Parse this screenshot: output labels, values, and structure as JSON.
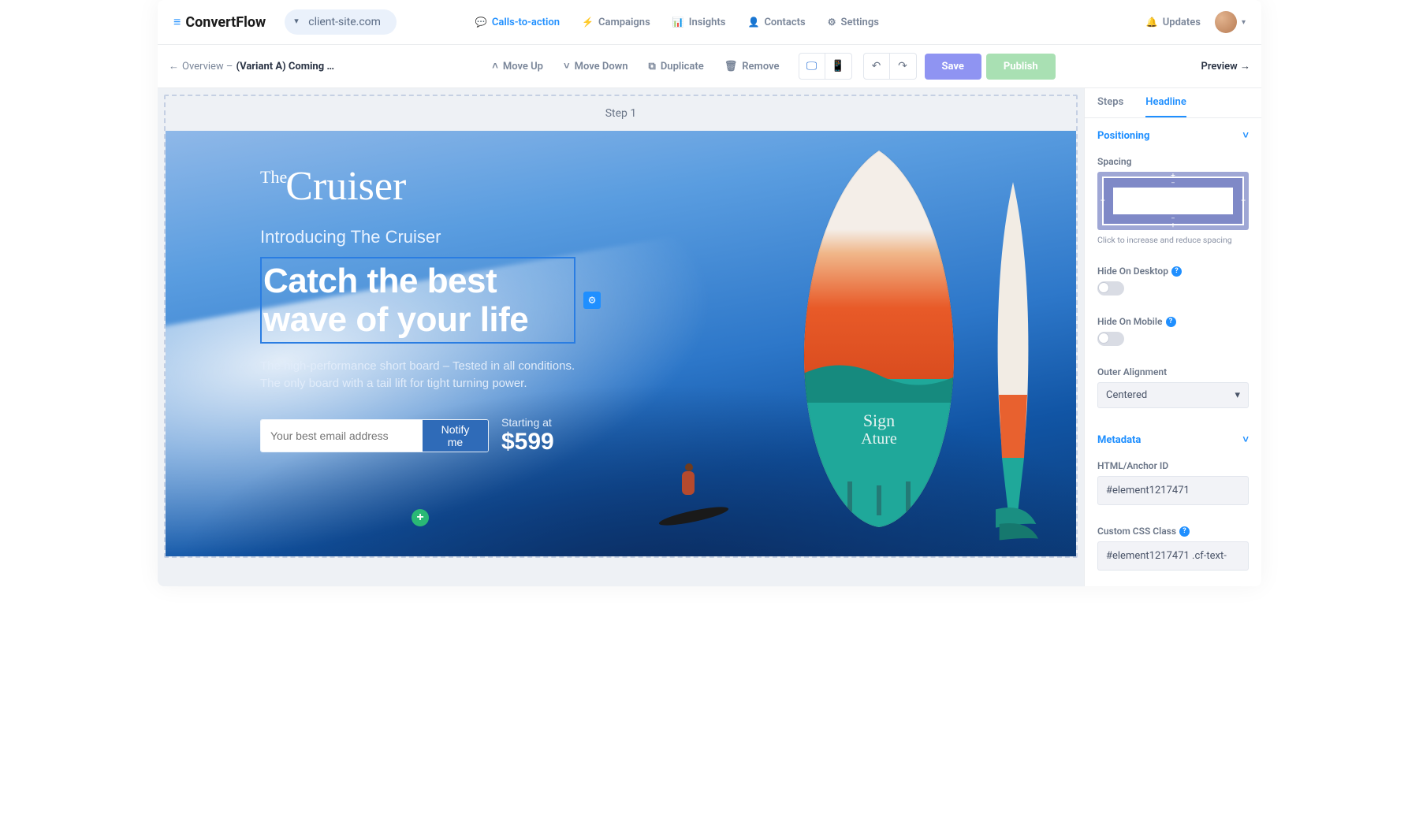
{
  "brand": "ConvertFlow",
  "site_switcher": "client-site.com",
  "nav": {
    "ctas": "Calls-to-action",
    "campaigns": "Campaigns",
    "insights": "Insights",
    "contacts": "Contacts",
    "settings": "Settings",
    "updates": "Updates"
  },
  "toolbar": {
    "back_arrow": "←",
    "overview": "Overview –",
    "variant": "(Variant A) Coming S…",
    "move_up": "Move Up",
    "move_down": "Move Down",
    "duplicate": "Duplicate",
    "remove": "Remove",
    "save": "Save",
    "publish": "Publish",
    "preview": "Preview →"
  },
  "canvas": {
    "step_label": "Step 1",
    "logo_the": "The",
    "logo_main": "Cruiser",
    "intro": "Introducing The Cruiser",
    "headline": "Catch the best wave of your life",
    "body": "The high-performance short board  – Tested in all conditions. The only board with a tail lift for tight turning power.",
    "email_placeholder": "Your best email address",
    "notify_button": "Notify me",
    "price_label": "Starting at",
    "price_value": "$599"
  },
  "sidebar": {
    "tab_steps": "Steps",
    "tab_headline": "Headline",
    "sec_positioning": "Positioning",
    "spacing_label": "Spacing",
    "spacing_hint": "Click to increase and reduce spacing",
    "hide_desktop": "Hide On Desktop",
    "hide_mobile": "Hide On Mobile",
    "outer_align_label": "Outer Alignment",
    "outer_align_value": "Centered",
    "sec_metadata": "Metadata",
    "anchor_label": "HTML/Anchor ID",
    "anchor_value": "#element1217471",
    "css_label": "Custom CSS Class",
    "css_value": "#element1217471 .cf-text-"
  }
}
